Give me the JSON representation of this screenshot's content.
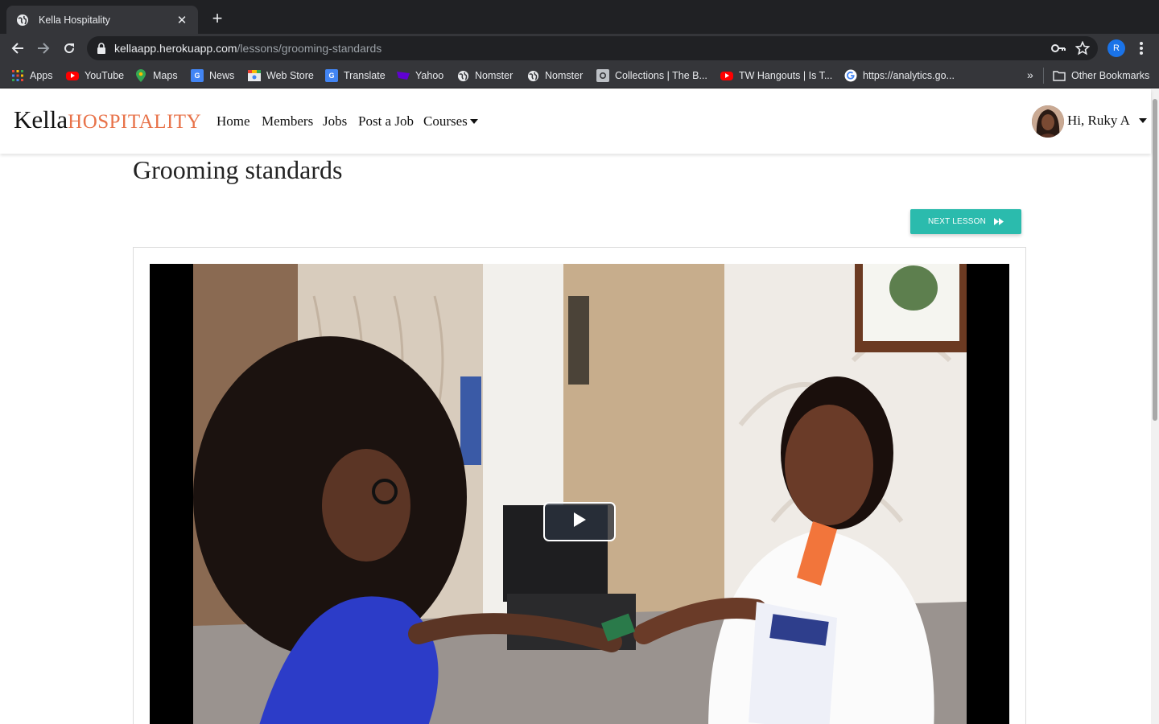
{
  "browser": {
    "tab_title": "Kella Hospitality",
    "url_host": "kellaapp.herokuapp.com",
    "url_path": "/lessons/grooming-standards",
    "profile_initial": "R",
    "bookmarks": [
      {
        "label": "Apps",
        "icon": "apps-grid-icon"
      },
      {
        "label": "YouTube",
        "icon": "youtube-icon"
      },
      {
        "label": "Maps",
        "icon": "maps-icon"
      },
      {
        "label": "News",
        "icon": "news-icon"
      },
      {
        "label": "Web Store",
        "icon": "web-store-icon"
      },
      {
        "label": "Translate",
        "icon": "translate-icon"
      },
      {
        "label": "Yahoo",
        "icon": "yahoo-icon"
      },
      {
        "label": "Nomster",
        "icon": "globe-icon"
      },
      {
        "label": "Nomster",
        "icon": "globe-icon"
      },
      {
        "label": "Collections | The B...",
        "icon": "collections-icon"
      },
      {
        "label": "TW Hangouts | Is T...",
        "icon": "youtube-icon"
      },
      {
        "label": "https://analytics.go...",
        "icon": "google-icon"
      }
    ],
    "other_bookmarks": "Other Bookmarks"
  },
  "site": {
    "brand_main": "Kella",
    "brand_accent": "HOSPITALITY",
    "brand_accent_color": "#e8734a",
    "nav": [
      "Home",
      "Members",
      "Jobs",
      "Post a Job",
      "Courses"
    ],
    "greeting": "Hi, Ruky A"
  },
  "lesson": {
    "title": "Grooming standards",
    "next_label": "NEXT LESSON",
    "next_color": "#2bbbad"
  }
}
